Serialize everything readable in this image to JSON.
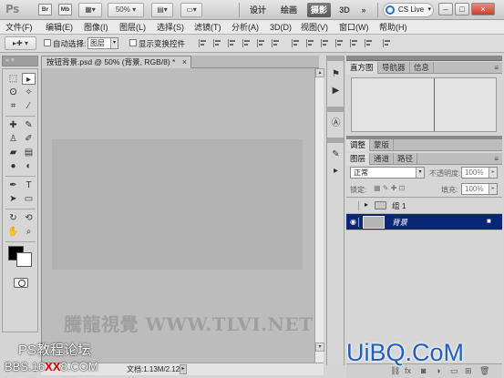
{
  "appbar": {
    "logo": "Ps",
    "icons": [
      "Br",
      "Mb"
    ],
    "zoom": "50%",
    "workspaces": [
      "设计",
      "绘画",
      "摄影"
    ],
    "active_workspace": "摄影",
    "mode3d": "3D",
    "more": "»",
    "cslive": "CS Live",
    "window_buttons": [
      "–",
      "□",
      "×"
    ]
  },
  "menubar": {
    "items": [
      "文件(F)",
      "编辑(E)",
      "图像(I)",
      "图层(L)",
      "选择(S)",
      "滤镜(T)",
      "分析(A)",
      "3D(D)",
      "视图(V)",
      "窗口(W)",
      "帮助(H)"
    ]
  },
  "options": {
    "auto_select_label": "自动选择:",
    "auto_select_value": "图层",
    "show_transform_label": "显示变换控件"
  },
  "document": {
    "tab_title": "按钮背景.psd @ 50% (背景, RGB/8) *",
    "tab_close": "×",
    "status_zoom": "50%",
    "status_doc": "文档:1.13M/2.12M"
  },
  "panels": {
    "top_tabs": [
      "直方图",
      "导航器",
      "信息"
    ],
    "adjust_tabs": [
      "调整",
      "蒙版"
    ],
    "layer_tabs": [
      "图层",
      "通道",
      "路径"
    ],
    "blend_mode": "正常",
    "opacity_label": "不透明度:",
    "opacity_value": "100%",
    "lock_label": "锁定:",
    "fill_label": "填充:",
    "fill_value": "100%",
    "layers": [
      {
        "name": "组 1",
        "type": "group",
        "visible": false,
        "selected": false
      },
      {
        "name": "背景",
        "type": "background",
        "visible": true,
        "selected": true
      }
    ]
  },
  "watermarks": {
    "center": "騰龍視覺 WWW.TLVI.NET",
    "ps_forum": "PS教程论坛",
    "bbs_prefix": "BBS.16",
    "bbs_red": "XX",
    "bbs_suffix": "8.COM",
    "uibq": "UiBQ.CoM"
  }
}
